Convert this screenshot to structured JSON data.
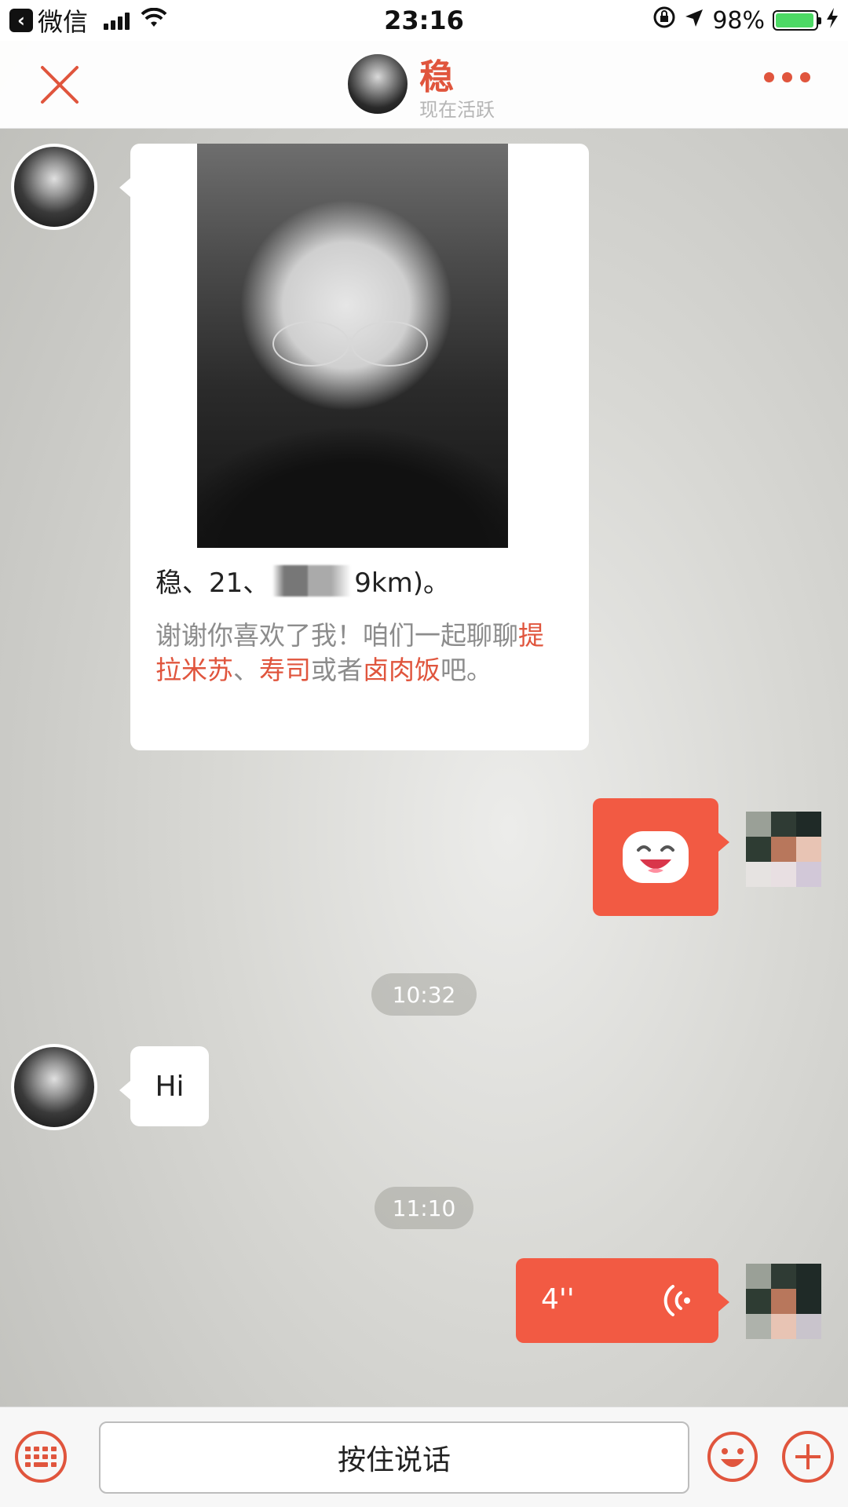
{
  "status_bar": {
    "back_app": "微信",
    "time": "23:16",
    "battery": "98%",
    "battery_level": 0.98
  },
  "header": {
    "name": "稳",
    "status": "现在活跃",
    "accent": "#e0553d"
  },
  "card": {
    "line1_prefix": "稳、21、",
    "line1_suffix": "9km)。",
    "desc_prefix": "谢谢你喜欢了我！咱们一起聊聊",
    "food1": "提拉米苏",
    "sep1": "、",
    "food2": "寿司",
    "sep2": "或者",
    "food3": "卤肉饭",
    "desc_suffix": "吧。"
  },
  "messages": {
    "timestamp1": "10:32",
    "hi_text": "Hi",
    "timestamp2": "11:10",
    "voice_length": "4''"
  },
  "input_bar": {
    "talk_label": "按住说话"
  },
  "colors": {
    "bubble_self": "#f25a43",
    "accent": "#e0553d"
  }
}
